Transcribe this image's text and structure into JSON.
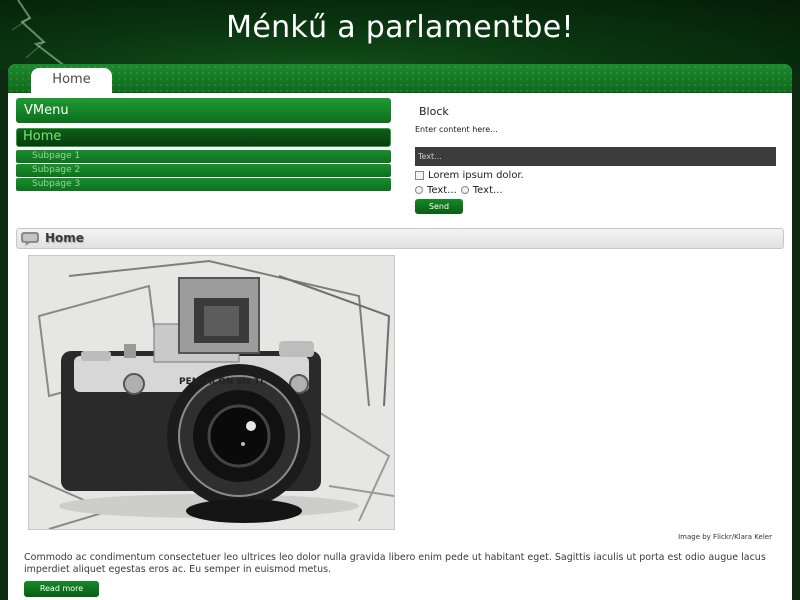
{
  "header": {
    "title": "Ménkű a parlamentbe!"
  },
  "nav": {
    "tabs": [
      {
        "label": "Home",
        "active": true
      }
    ]
  },
  "vmenu": {
    "title": "VMenu",
    "items": [
      {
        "label": "Home",
        "active": true
      },
      {
        "label": "Subpage 1"
      },
      {
        "label": "Subpage 2"
      },
      {
        "label": "Subpage 3"
      }
    ]
  },
  "block": {
    "title": "Block",
    "content": "Enter content here...",
    "input_value": "Text...",
    "checkbox_label": "Lorem ipsum dolor.",
    "radio_labels": [
      "Text...",
      "Text..."
    ],
    "send_label": "Send"
  },
  "post": {
    "title": "Home",
    "image_caption": "Image by Flickr/Klara Keler",
    "camera_brand": "PENTACON six TL",
    "body": "Commodo ac condimentum consectetuer leo ultrices leo dolor nulla gravida libero enim pede ut habitant eget. Sagittis iaculis ut porta est odio augue lacus imperdiet aliquet egestas eros ac. Eu semper in euismod metus.",
    "read_more_label": "Read more"
  },
  "colors": {
    "header_bg": "#0a3510",
    "accent_green": "#1a8f2c",
    "button_green": "#0a5c15",
    "active_menu_text": "#7fe36f"
  }
}
